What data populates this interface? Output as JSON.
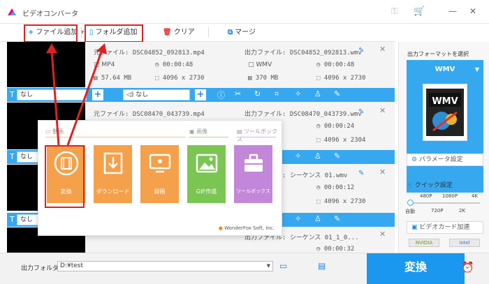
{
  "app": {
    "title": "ビデオコンバータ"
  },
  "toolbar": {
    "add_file": "ファイル追加",
    "add_folder": "フォルダ追加",
    "clear": "クリア",
    "merge": "マージ"
  },
  "rows": [
    {
      "src_file": "元ファイル: DSC04852_092813.mp4",
      "src_format": "MP4",
      "src_duration": "00:00:48",
      "src_size": "57.64 MB",
      "src_resolution": "4096 x 2730",
      "out_file": "出力ファイル: DSC04852_092813.wmv",
      "out_format": "WMV",
      "out_duration": "00:00:48",
      "out_size": "370 MB",
      "out_resolution": "4096 x 2730"
    },
    {
      "src_file": "元ファイル: DSC08470_043739.mp4",
      "out_file": "出力ファイル: DSC08470_043739.wmv",
      "out_duration": "00:00:24",
      "out_resolution": "4096 x 2304"
    },
    {
      "out_file": "出力ファイル: シーケンス 01.wmv",
      "out_duration": "00:00:12",
      "out_resolution": "4096 x 2730"
    },
    {
      "out_file": "出力ファイル: シーケンス 01_1_0...",
      "out_duration": "00:00:32"
    }
  ],
  "bar": {
    "subtitle": "なし",
    "audio": "なし"
  },
  "popup": {
    "cat_video": "動画",
    "cat_image": "画像",
    "cat_toolbox": "ツールボックス",
    "tiles": [
      "変換",
      "ダウンロード",
      "録画",
      "GIF作成",
      "ツールボックス"
    ],
    "brand": "WonderFox Soft, Inc."
  },
  "right": {
    "title": "出力フォーマットを選択",
    "format": "WMV",
    "format_logo": "WMV",
    "param": "パラメータ設定",
    "quick": "クイック設定",
    "ticks_top": [
      "480P",
      "1080P",
      "4K"
    ],
    "ticks_bottom": [
      "自動",
      "720P",
      "2K"
    ],
    "gpu": "ビデオカード加速",
    "badges": [
      "NVIDIA",
      "Intel"
    ]
  },
  "bottom": {
    "out_label": "出力フォルダ：",
    "out_path": "D:¥test",
    "convert": "変換"
  },
  "colors": {
    "accent": "#1a98f0",
    "highlight": "#e02020",
    "tile_orange": "#f5a04a",
    "tile_green": "#7bc653",
    "tile_purple": "#c287d9"
  }
}
